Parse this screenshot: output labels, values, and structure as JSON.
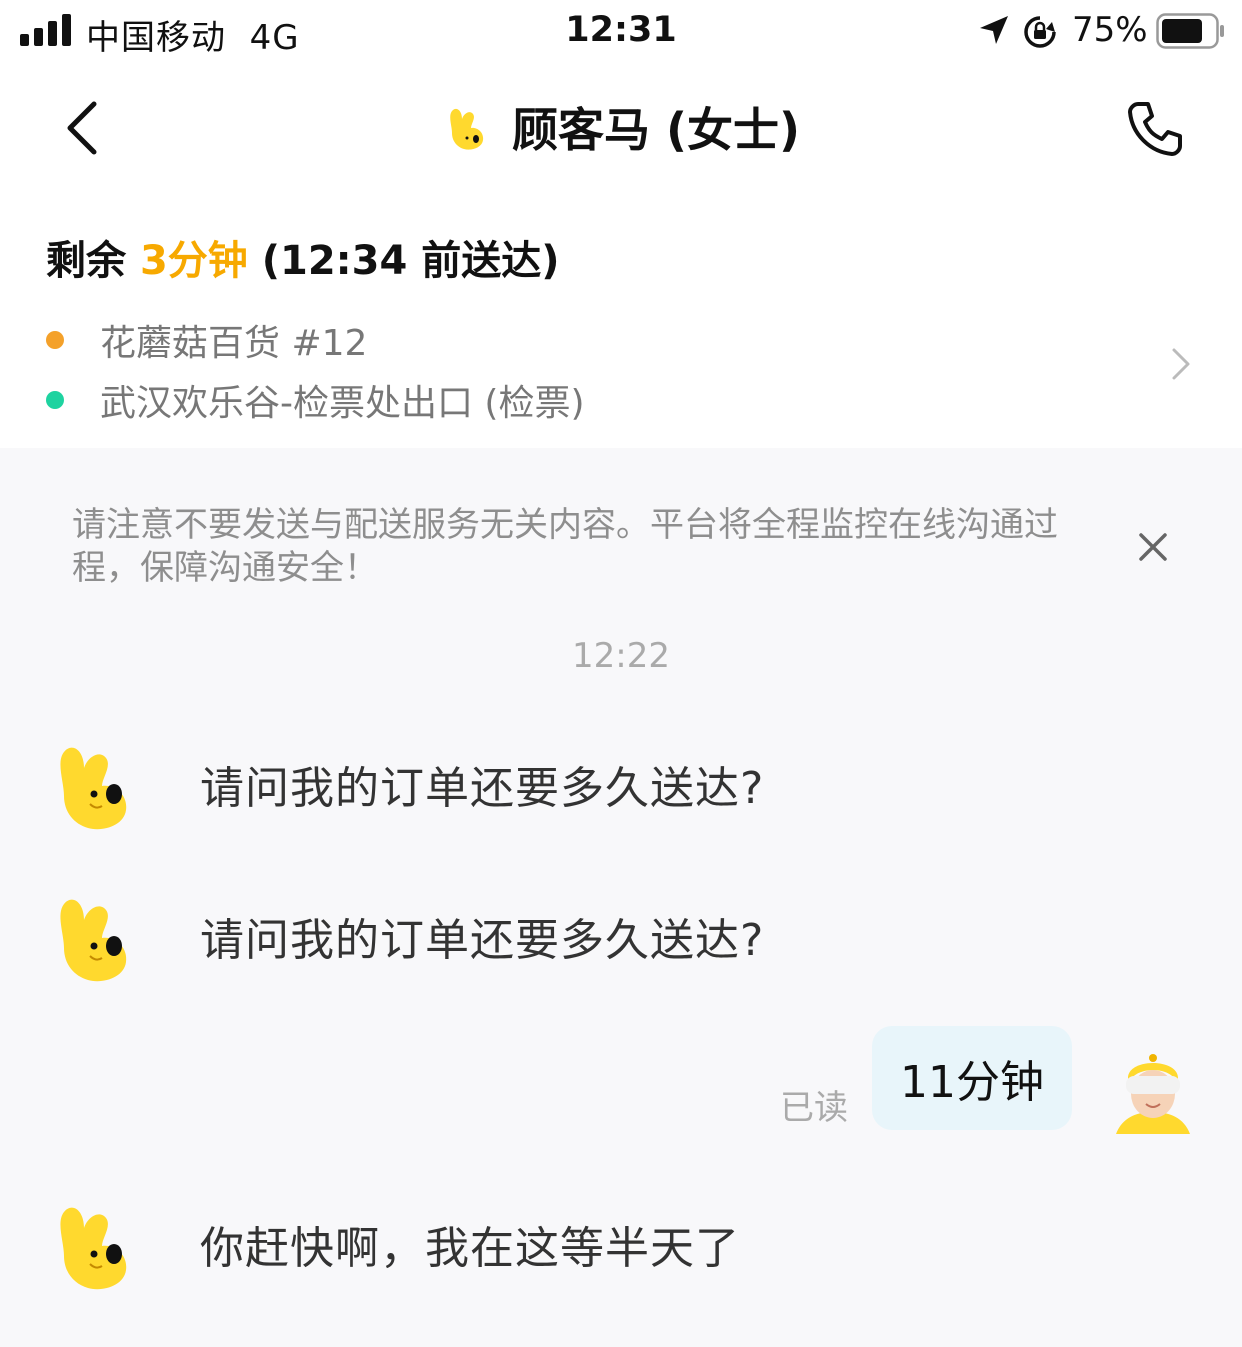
{
  "status_bar": {
    "carrier": "中国移动",
    "network": "4G",
    "time": "12:31",
    "battery_percent": "75%",
    "battery_level": 0.75,
    "icons": [
      "signal-icon",
      "location-arrow-icon",
      "rotation-lock-icon",
      "battery-icon"
    ]
  },
  "nav": {
    "title": "顾客马 (女士)",
    "back_icon": "chevron-left-icon",
    "call_icon": "phone-icon",
    "avatar_icon": "yellow-mascot-icon"
  },
  "order": {
    "eta_prefix": "剩余 ",
    "eta_highlight": "3分钟",
    "eta_suffix": " (12:34 前送达)",
    "stops": [
      {
        "label": "花蘑菇百货 #12",
        "color": "#f4a12a"
      },
      {
        "label": "武汉欢乐谷-检票处出口 (检票)",
        "color": "#1ed3a0"
      }
    ]
  },
  "chat": {
    "notice": "请注意不要发送与配送服务无关内容。平台将全程监控在线沟通过程，保障沟通安全！",
    "timestamp": "12:22",
    "messages": [
      {
        "from": "customer",
        "text": "请问我的订单还要多久送达?"
      },
      {
        "from": "customer",
        "text": "请问我的订单还要多久送达?"
      },
      {
        "from": "rider",
        "text": "11分钟",
        "status": "已读"
      },
      {
        "from": "customer",
        "text": "你赶快啊，我在这等半天了"
      }
    ]
  },
  "colors": {
    "accent": "#f7a900",
    "bubble_out": "#e8f5fa",
    "mascot_yellow": "#ffd92e",
    "chat_bg": "#f8f8fa"
  }
}
